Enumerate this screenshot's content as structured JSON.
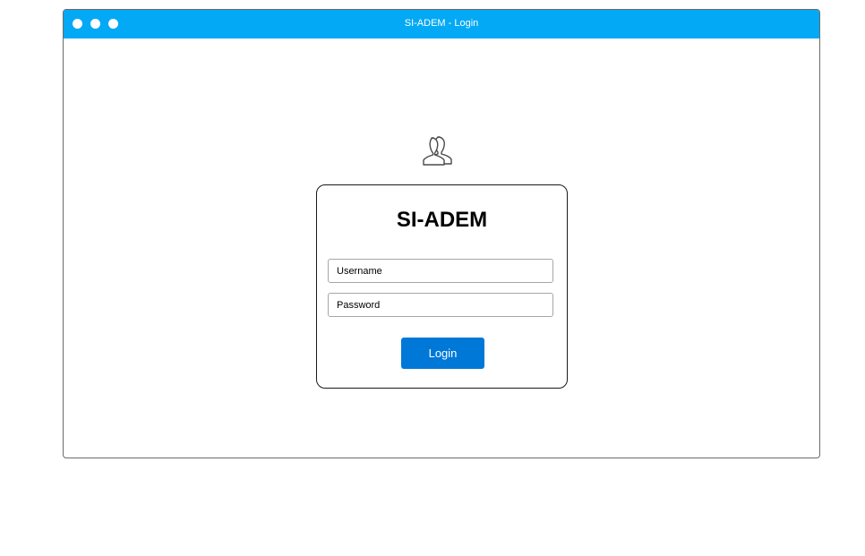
{
  "window": {
    "title": "SI-ADEM - Login",
    "titlebar_color": "#03a9f4"
  },
  "login": {
    "icon": "users-icon",
    "brand": "SI-ADEM",
    "username_placeholder": "Username",
    "password_placeholder": "Password",
    "submit_label": "Login",
    "submit_color": "#0078d7"
  }
}
